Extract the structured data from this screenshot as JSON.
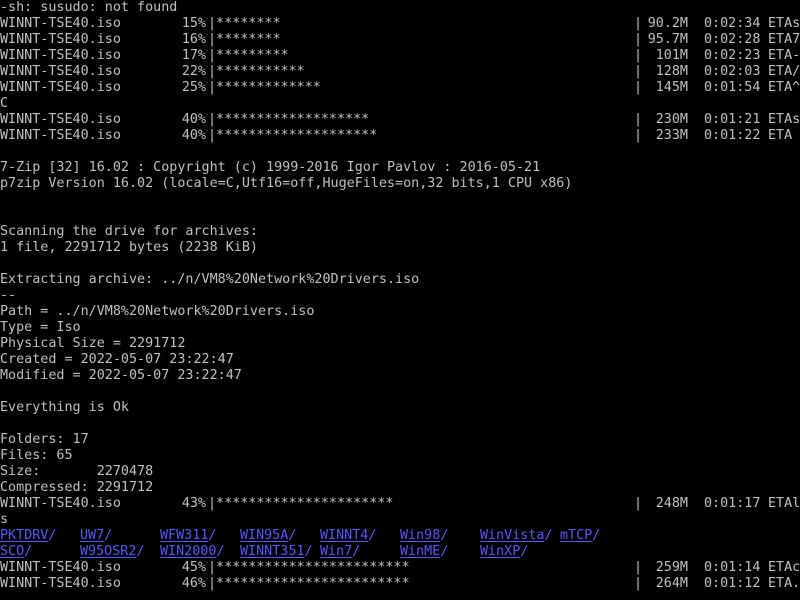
{
  "terminal": {
    "colors": {
      "background": "#000000",
      "foreground": "#c0c0c0",
      "directory": "#5555ff"
    },
    "shell_error": "-sh: susudo: not found",
    "progress_before": [
      {
        "file": "WINNT-TSE40.iso",
        "pct": "15%",
        "bar": "|********",
        "pipe": "|",
        "size": "90.2M",
        "time": "0:02:34",
        "eta": "ETAs"
      },
      {
        "file": "WINNT-TSE40.iso",
        "pct": "16%",
        "bar": "|********",
        "pipe": "|",
        "size": "95.7M",
        "time": "0:02:28",
        "eta": "ETA7"
      },
      {
        "file": "WINNT-TSE40.iso",
        "pct": "17%",
        "bar": "|*********",
        "pipe": "|",
        "size": "101M",
        "time": "0:02:23",
        "eta": "ETA-"
      },
      {
        "file": "WINNT-TSE40.iso",
        "pct": "22%",
        "bar": "|***********",
        "pipe": "|",
        "size": "128M",
        "time": "0:02:03",
        "eta": "ETA/"
      },
      {
        "file": "WINNT-TSE40.iso",
        "pct": "25%",
        "bar": "|*************",
        "pipe": "|",
        "size": "145M",
        "time": "0:01:54",
        "eta": "ETA^"
      }
    ],
    "stray_char": "C",
    "progress_middle": [
      {
        "file": "WINNT-TSE40.iso",
        "pct": "40%",
        "bar": "|*******************",
        "pipe": "|",
        "size": "230M",
        "time": "0:01:21",
        "eta": "ETAs"
      },
      {
        "file": "WINNT-TSE40.iso",
        "pct": "40%",
        "bar": "|********************",
        "pipe": "|",
        "size": "233M",
        "time": "0:01:22",
        "eta": "ETA"
      }
    ],
    "sevenzip_banner": "7-Zip [32] 16.02 : Copyright (c) 1999-2016 Igor Pavlov : 2016-05-21",
    "p7zip_version": "p7zip Version 16.02 (locale=C,Utf16=off,HugeFiles=on,32 bits,1 CPU x86)",
    "scanning": "Scanning the drive for archives:",
    "scan_result": "1 file, 2291712 bytes (2238 KiB)",
    "extracting": "Extracting archive: ../n/VM8%20Network%20Drivers.iso",
    "separator": "--",
    "path_line": "Path = ../n/VM8%20Network%20Drivers.iso",
    "type_line": "Type = Iso",
    "physical_size_line": "Physical Size = 2291712",
    "created_line": "Created = 2022-05-07 23:22:47",
    "modified_line": "Modified = 2022-05-07 23:22:47",
    "everything_ok": "Everything is Ok",
    "folders_line": "Folders: 17",
    "files_line": "Files: 65",
    "size_line": "Size:       2270478",
    "compressed_line": "Compressed: 2291712",
    "progress_after_extract": {
      "file": "WINNT-TSE40.iso",
      "pct": "43%",
      "bar": "|**********************",
      "pipe": "|",
      "size": "248M",
      "time": "0:01:17",
      "eta": "ETAl"
    },
    "ls_command_tail": "s",
    "dir_row_1": [
      {
        "name": "PKTDRV",
        "slash": "/"
      },
      {
        "name": "UW7",
        "slash": "/"
      },
      {
        "name": "WFW311",
        "slash": "/"
      },
      {
        "name": "WIN95A",
        "slash": "/"
      },
      {
        "name": "WINNT4",
        "slash": "/"
      },
      {
        "name": "Win98",
        "slash": "/"
      },
      {
        "name": "WinVista",
        "slash": "/"
      },
      {
        "name": "mTCP",
        "slash": "/"
      }
    ],
    "dir_row_2": [
      {
        "name": "SCO",
        "slash": "/"
      },
      {
        "name": "W95OSR2",
        "slash": "/"
      },
      {
        "name": "WIN2000",
        "slash": "/"
      },
      {
        "name": "WINNT351",
        "slash": "/"
      },
      {
        "name": "Win7",
        "slash": "/"
      },
      {
        "name": "WinME",
        "slash": "/"
      },
      {
        "name": "WinXP",
        "slash": "/"
      }
    ],
    "progress_final": [
      {
        "file": "WINNT-TSE40.iso",
        "pct": "45%",
        "bar": "|************************",
        "pipe": "|",
        "size": "259M",
        "time": "0:01:14",
        "eta": "ETAc"
      },
      {
        "file": "WINNT-TSE40.iso",
        "pct": "46%",
        "bar": "|************************",
        "pipe": "|",
        "size": "264M",
        "time": "0:01:12",
        "eta": "ETA."
      }
    ]
  }
}
